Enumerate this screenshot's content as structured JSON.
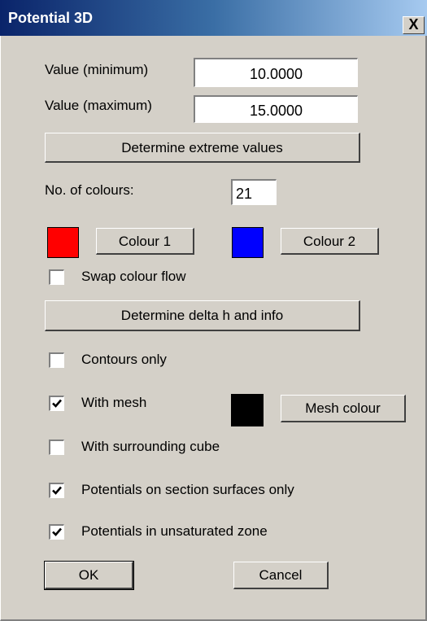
{
  "window": {
    "title": "Potential 3D",
    "close_glyph": "X"
  },
  "values": {
    "min_label": "Value (minimum)",
    "min_value": "10.0000",
    "max_label": "Value (maximum)",
    "max_value": "15.0000",
    "determine_button": "Determine extreme values"
  },
  "colours": {
    "count_label": "No. of colours:",
    "count_value": "21",
    "colour1_label": "Colour 1",
    "colour1": "#ff0000",
    "colour2_label": "Colour 2",
    "colour2": "#0000ff",
    "swap_label": "Swap colour flow",
    "swap_checked": false
  },
  "delta_button": "Determine delta h and info",
  "options": {
    "contours_label": "Contours only",
    "contours_checked": false,
    "mesh_label": "With mesh",
    "mesh_checked": true,
    "mesh_colour": "#000000",
    "mesh_colour_label": "Mesh colour",
    "cube_label": "With surrounding cube",
    "cube_checked": false,
    "section_label": "Potentials on section surfaces only",
    "section_checked": true,
    "unsaturated_label": "Potentials in unsaturated zone",
    "unsaturated_checked": true
  },
  "buttons": {
    "ok": "OK",
    "cancel": "Cancel"
  }
}
